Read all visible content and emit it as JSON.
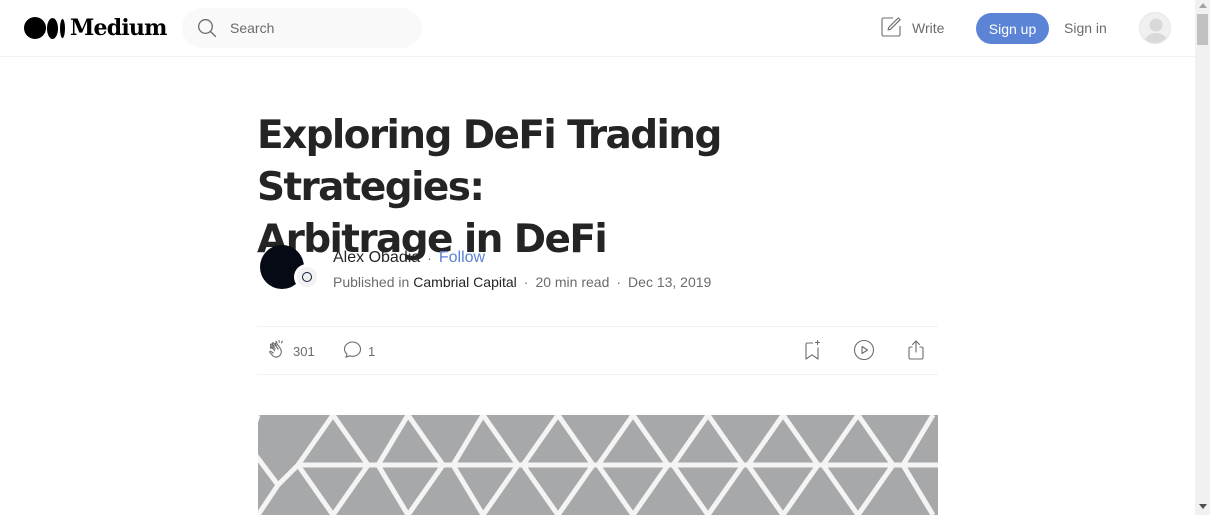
{
  "header": {
    "brand": "Medium",
    "search_placeholder": "Search",
    "write_label": "Write",
    "signup_label": "Sign up",
    "signin_label": "Sign in"
  },
  "article": {
    "title_line1": "Exploring DeFi Trading Strategies:",
    "title_line2": "Arbitrage in DeFi",
    "author": "Alex Obadia",
    "separator": "·",
    "follow_label": "Follow",
    "published_in_label": "Published in",
    "publication": "Cambrial Capital",
    "read_time": "20 min read",
    "date": "Dec 13, 2019"
  },
  "actions": {
    "claps": "301",
    "responses": "1",
    "icons": [
      "clap-icon",
      "comment-icon",
      "bookmark-icon",
      "play-icon",
      "share-icon"
    ]
  },
  "colors": {
    "accent": "#5b83d6",
    "text": "#242424",
    "muted": "#6b6b6b",
    "hero_bg": "#a6a8aa"
  }
}
